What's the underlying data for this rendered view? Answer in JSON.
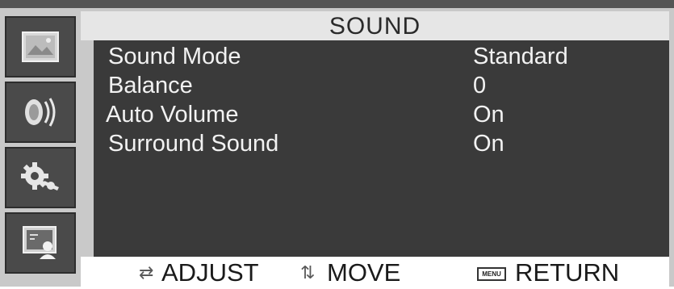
{
  "menu": {
    "title": "SOUND",
    "tabs": [
      {
        "name": "picture",
        "icon": "picture-icon"
      },
      {
        "name": "sound",
        "icon": "speaker-icon"
      },
      {
        "name": "setup",
        "icon": "gears-icon"
      },
      {
        "name": "input",
        "icon": "screen-user-icon"
      }
    ],
    "items": [
      {
        "label": "Sound Mode",
        "value": "Standard"
      },
      {
        "label": "Balance",
        "value": "0"
      },
      {
        "label": "Auto Volume",
        "value": "On"
      },
      {
        "label": "Surround Sound",
        "value": "On"
      }
    ]
  },
  "footer": {
    "adjust_icon": "⇄",
    "adjust_label": "ADJUST",
    "move_icon": "⇅",
    "move_label": "MOVE",
    "menu_badge": "MENU",
    "return_label": "RETURN"
  },
  "colors": {
    "frame": "#c9c9c9",
    "panel": "#3a3a3a",
    "tab": "#4a4a4a",
    "text": "#f2f2f2"
  }
}
